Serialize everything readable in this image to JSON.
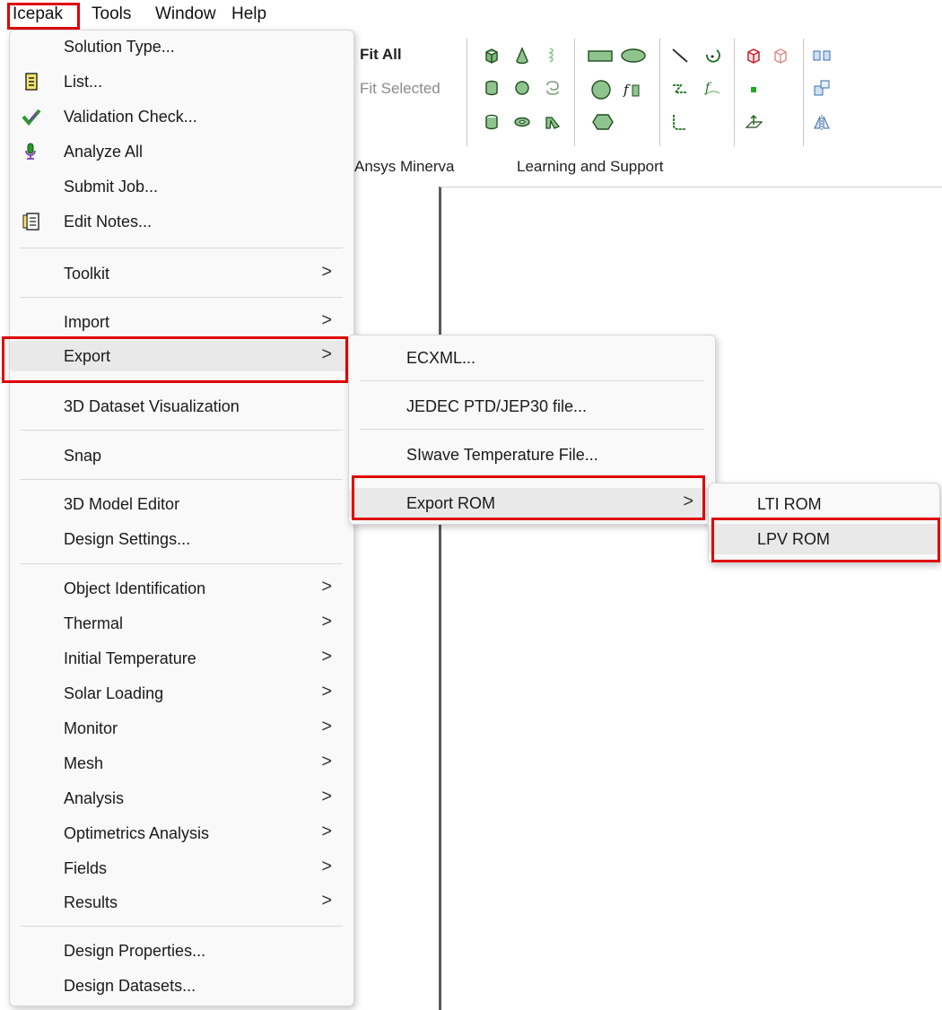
{
  "menubar": {
    "items": [
      "Icepak",
      "Tools",
      "Window",
      "Help"
    ]
  },
  "toolbar": {
    "fit_all": "Fit All",
    "fit_selected": "Fit Selected",
    "ribbon_tabs": [
      "Ansys Minerva",
      "Learning and Support"
    ]
  },
  "icepak_menu": {
    "items": [
      {
        "label": "Solution Type...",
        "icon": "",
        "submenu": false
      },
      {
        "label": "List...",
        "icon": "list-icon",
        "submenu": false
      },
      {
        "label": "Validation Check...",
        "icon": "validation-check-icon",
        "submenu": false
      },
      {
        "label": "Analyze All",
        "icon": "analyze-all-icon",
        "submenu": false
      },
      {
        "label": "Submit Job...",
        "icon": "",
        "submenu": false
      },
      {
        "label": "Edit Notes...",
        "icon": "notes-icon",
        "submenu": false
      },
      {
        "label": "Toolkit",
        "submenu": true
      },
      {
        "label": "Import",
        "submenu": true
      },
      {
        "label": "Export",
        "submenu": true,
        "selected": true
      },
      {
        "label": "3D Dataset Visualization",
        "submenu": false
      },
      {
        "label": "Snap",
        "submenu": false
      },
      {
        "label": "3D Model Editor",
        "submenu": false
      },
      {
        "label": "Design Settings...",
        "submenu": false
      },
      {
        "label": "Object Identification",
        "submenu": true
      },
      {
        "label": "Thermal",
        "submenu": true
      },
      {
        "label": "Initial Temperature",
        "submenu": true
      },
      {
        "label": "Solar Loading",
        "submenu": true
      },
      {
        "label": "Monitor",
        "submenu": true
      },
      {
        "label": "Mesh",
        "submenu": true
      },
      {
        "label": "Analysis",
        "submenu": true
      },
      {
        "label": "Optimetrics Analysis",
        "submenu": true
      },
      {
        "label": "Fields",
        "submenu": true
      },
      {
        "label": "Results",
        "submenu": true
      },
      {
        "label": "Design Properties...",
        "submenu": false
      },
      {
        "label": "Design Datasets...",
        "submenu": false
      }
    ]
  },
  "export_menu": {
    "items": [
      {
        "label": "ECXML...",
        "submenu": false
      },
      {
        "label": "JEDEC PTD/JEP30 file...",
        "submenu": false
      },
      {
        "label": "SIwave Temperature File...",
        "submenu": false
      },
      {
        "label": "Export ROM",
        "submenu": true,
        "selected": true
      }
    ]
  },
  "rom_menu": {
    "items": [
      {
        "label": "LTI ROM",
        "submenu": false
      },
      {
        "label": "LPV ROM",
        "submenu": false,
        "selected": true
      }
    ]
  },
  "colors": {
    "highlight": "#e00000",
    "menu_bg": "#f9f9f9",
    "selected_bg": "#e9e9e9"
  },
  "arrow_glyph": ">"
}
